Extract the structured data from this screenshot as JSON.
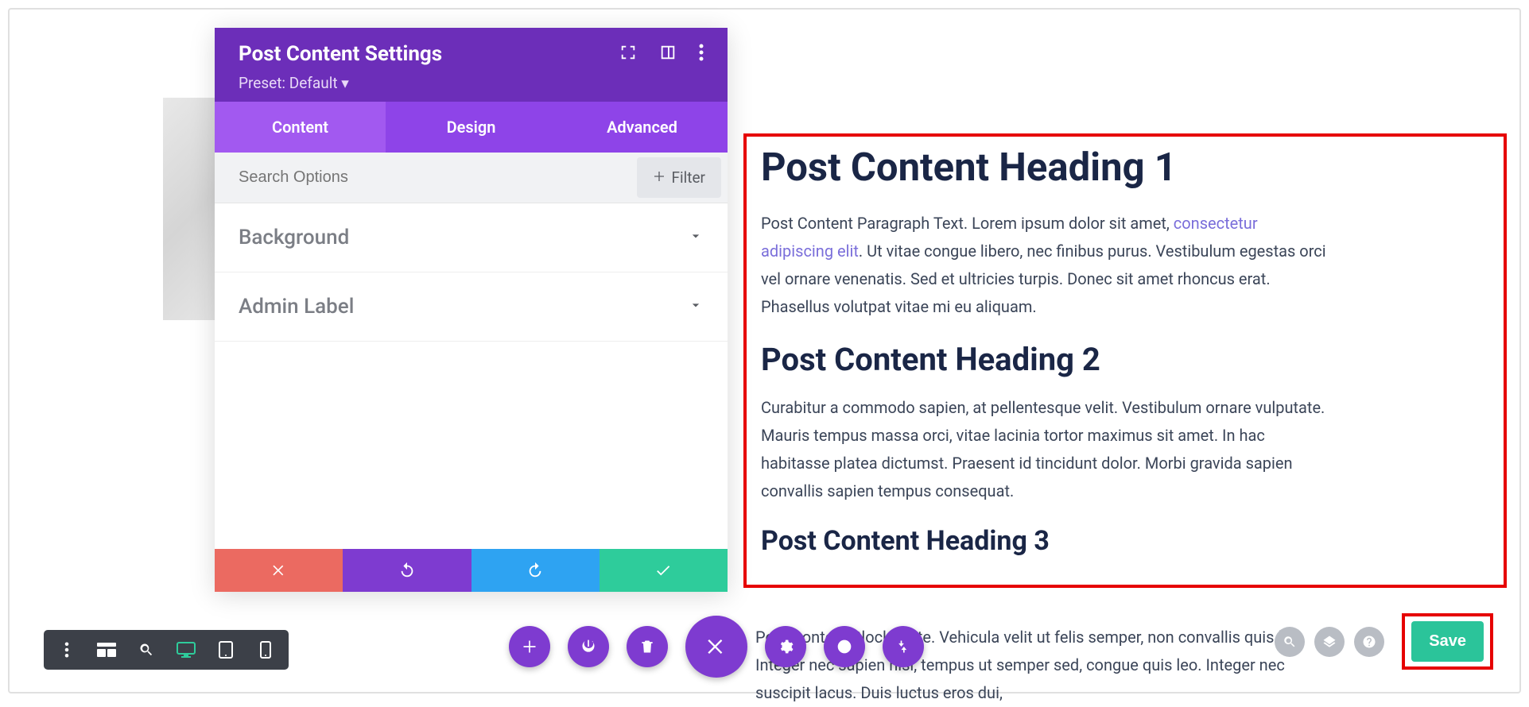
{
  "modal": {
    "title": "Post Content Settings",
    "preset": "Preset: Default ▾",
    "tabs": [
      "Content",
      "Design",
      "Advanced"
    ],
    "active_tab": 0,
    "search_placeholder": "Search Options",
    "filter_label": "Filter",
    "options": [
      {
        "label": "Background"
      },
      {
        "label": "Admin Label"
      }
    ]
  },
  "post": {
    "h1": "Post Content Heading 1",
    "p1_a": "Post Content Paragraph Text. Lorem ipsum dolor sit amet, ",
    "p1_link": "consectetur adipiscing elit",
    "p1_b": ". Ut vitae congue libero, nec finibus purus. Vestibulum egestas orci vel ornare venenatis. Sed et ultricies turpis. Donec sit amet rhoncus erat. Phasellus volutpat vitae mi eu aliquam.",
    "h2": "Post Content Heading 2",
    "p2": "Curabitur a commodo sapien, at pellentesque velit. Vestibulum ornare vulputate. Mauris tempus massa orci, vitae lacinia tortor maximus sit amet. In hac habitasse platea dictumst. Praesent id tincidunt dolor. Morbi gravida sapien convallis sapien tempus consequat.",
    "h3": "Post Content Heading 3",
    "bottom": "Post Content Blockquote. Vehicula velit ut felis semper, non convallis quis leo. Integer nec sapien nisl, tempus ut semper sed, congue quis leo. Integer nec suscipit lacus. Duis luctus eros dui,"
  },
  "save_label": "Save"
}
